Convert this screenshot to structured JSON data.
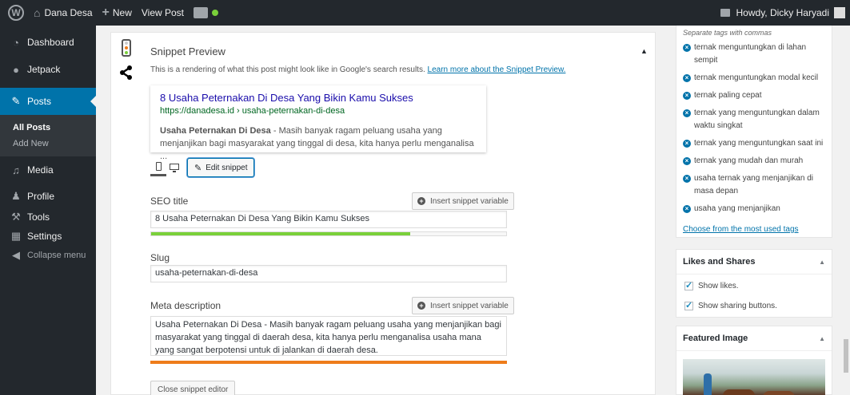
{
  "admin_bar": {
    "site_name": "Dana Desa",
    "new_label": "New",
    "view_post_label": "View Post",
    "howdy": "Howdy, Dicky Haryadi"
  },
  "sidebar": {
    "items": [
      {
        "icon": "dashboard-icon",
        "label": "Dashboard"
      },
      {
        "icon": "jetpack-icon",
        "label": "Jetpack"
      },
      {
        "icon": "pin-icon",
        "label": "Posts"
      },
      {
        "icon": "media-icon",
        "label": "Media"
      },
      {
        "icon": "user-icon",
        "label": "Profile"
      },
      {
        "icon": "wrench-icon",
        "label": "Tools"
      },
      {
        "icon": "settings-icon",
        "label": "Settings"
      },
      {
        "icon": "collapse-icon",
        "label": "Collapse menu"
      }
    ],
    "posts_submenu": [
      "All Posts",
      "Add New"
    ]
  },
  "snippet": {
    "heading": "Snippet Preview",
    "description": "This is a rendering of what this post might look like in Google's search results.",
    "learn_more": "Learn more about the Snippet Preview.",
    "preview_title": "8 Usaha Peternakan Di Desa Yang Bikin Kamu Sukses",
    "preview_url": "https://danadesa.id › usaha-peternakan-di-desa",
    "preview_desc_bold": "Usaha Peternakan Di Desa",
    "preview_desc": " - Masih banyak ragam peluang usaha yang menjanjikan bagi masyarakat yang tinggal di desa, kita hanya perlu menganalisa ...",
    "edit_snippet_label": "Edit snippet",
    "seo_title_label": "SEO title",
    "insert_variable_label": "Insert snippet variable",
    "seo_title_value": "8 Usaha Peternakan Di Desa Yang Bikin Kamu Sukses",
    "seo_title_progress": 0.73,
    "slug_label": "Slug",
    "slug_value": "usaha-peternakan-di-desa",
    "meta_label": "Meta description",
    "meta_value": "Usaha Peternakan Di Desa - Masih banyak ragam peluang usaha yang menjanjikan bagi masyarakat yang tinggal di daerah desa, kita hanya perlu menganalisa usaha mana yang sangat berpotensi untuk di jalankan di daerah desa.",
    "meta_progress": 1.0,
    "close_editor_label": "Close snippet editor"
  },
  "tags": {
    "hint": "Separate tags with commas",
    "items": [
      "ternak menguntungkan di lahan sempit",
      "ternak menguntungkan modal kecil",
      "ternak paling cepat",
      "ternak yang menguntungkan dalam waktu singkat",
      "ternak yang menguntungkan saat ini",
      "ternak yang mudah dan murah",
      "usaha ternak yang menjanjikan di masa depan",
      "usaha yang menjanjikan"
    ],
    "choose_link": "Choose from the most used tags"
  },
  "likes": {
    "heading": "Likes and Shares",
    "show_likes": "Show likes.",
    "show_sharing": "Show sharing buttons."
  },
  "featured": {
    "heading": "Featured Image"
  },
  "colors": {
    "admin_dark": "#23282d",
    "accent": "#0073aa",
    "progress_green": "#7ad03a",
    "progress_orange": "#ee7c1b"
  }
}
